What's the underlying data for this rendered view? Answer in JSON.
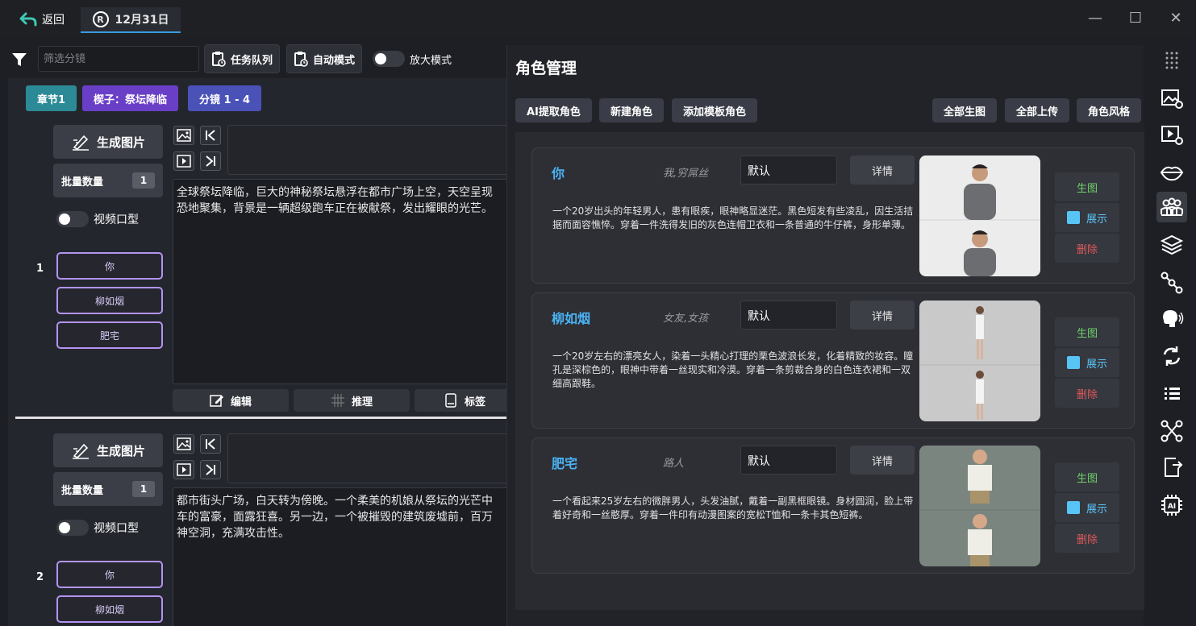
{
  "titlebar": {
    "back_label": "返回",
    "date_tab_label": "12月31日",
    "date_tab_icon": "R"
  },
  "toolbar": {
    "filter_placeholder": "筛选分镜",
    "task_queue": "任务队列",
    "auto_mode": "自动模式",
    "zoom_mode": "放大模式"
  },
  "tags": {
    "chapter": "章节1",
    "prologue": "楔子：祭坛降临",
    "shots": "分镜 1 - 4"
  },
  "colors": {
    "accent_blue": "#4ab3f4",
    "chapter_tag": "#2b8a96",
    "prologue_tag": "#6a3fc7",
    "shots_tag": "#4a52b8",
    "char_border": "#b294f0",
    "gen_green": "#6fcf6a",
    "delete_red": "#e05a5a"
  },
  "shots": [
    {
      "number": "1",
      "gen_label": "生成图片",
      "batch_label": "批量数量",
      "batch_value": "1",
      "lip_label": "视频口型",
      "characters": [
        "你",
        "柳如烟",
        "肥宅"
      ],
      "description_lines": [
        "全球祭坛降临，巨大的神秘祭坛悬浮在都市广场上空，天空呈现",
        "恐地聚集，背景是一辆超级跑车正在被献祭，发出耀眼的光芒。"
      ],
      "actions": [
        "编辑",
        "推理",
        "标签"
      ]
    },
    {
      "number": "2",
      "gen_label": "生成图片",
      "batch_label": "批量数量",
      "batch_value": "1",
      "lip_label": "视频口型",
      "characters": [
        "你",
        "柳如烟"
      ],
      "description_lines": [
        "都市街头广场，白天转为傍晚。一个柔美的机娘从祭坛的光芒中",
        "车的富豪，面露狂喜。另一边，一个被摧毁的建筑废墟前，百万",
        "神空洞，充满攻击性。"
      ]
    }
  ],
  "role_panel": {
    "title": "角色管理",
    "buttons_left": [
      "AI提取角色",
      "新建角色",
      "添加模板角色"
    ],
    "buttons_right": [
      "全部生图",
      "全部上传",
      "角色风格"
    ],
    "detail_label": "详情",
    "gen_label": "生图",
    "show_label": "展示",
    "delete_label": "删除",
    "characters": [
      {
        "name": "你",
        "role": "我,穷屌丝",
        "voice": "默认",
        "desc": "一个20岁出头的年轻男人，患有眼疾，眼神略显迷茫。黑色短发有些凌乱，因生活拮据而面容憔悴。穿着一件洗得发旧的灰色连帽卫衣和一条普通的牛仔裤，身形单薄。"
      },
      {
        "name": "柳如烟",
        "role": "女友,女孩",
        "voice": "默认",
        "desc": "一个20岁左右的漂亮女人，染着一头精心打理的栗色波浪长发，化着精致的妆容。瞳孔是深棕色的，眼神中带着一丝现实和冷漠。穿着一条剪裁合身的白色连衣裙和一双细高跟鞋。"
      },
      {
        "name": "肥宅",
        "role": "路人",
        "voice": "默认",
        "desc": "一个看起来25岁左右的微胖男人，头发油腻，戴着一副黑框眼镜。身材圆润，脸上带着好奇和一丝憨厚。穿着一件印有动漫图案的宽松T恤和一条卡其色短裤。"
      }
    ]
  },
  "sidebar_icons": [
    "dots-grid-icon",
    "image-settings-icon",
    "video-settings-icon",
    "lips-icon",
    "characters-icon",
    "layers-icon",
    "nodes-icon",
    "voice-icon",
    "sync-icon",
    "list-icon",
    "workflow-icon",
    "export-icon",
    "ai-chip-icon"
  ]
}
